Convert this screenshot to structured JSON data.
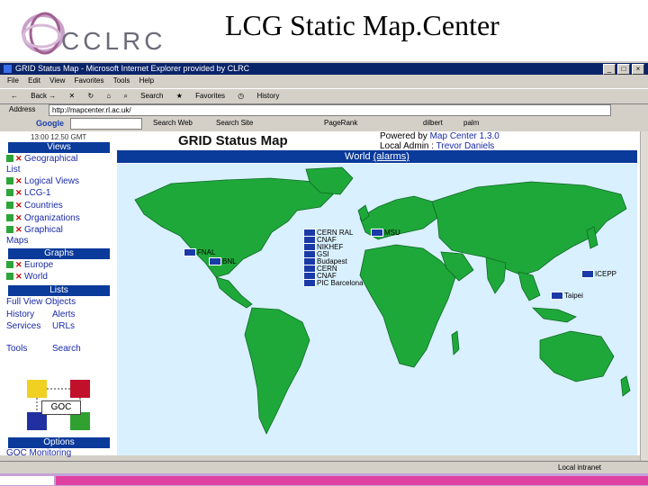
{
  "slide": {
    "title": "LCG Static Map.Center",
    "logo_text": "CCLRC"
  },
  "browser": {
    "window_title": "GRID Status Map - Microsoft Internet Explorer provided by CLRC",
    "menu": [
      "File",
      "Edit",
      "View",
      "Favorites",
      "Tools",
      "Help"
    ],
    "toolbar": [
      "Back",
      "Search",
      "Favorites",
      "History"
    ],
    "address_label": "Address",
    "address_value": "http://mapcenter.rl.ac.uk/",
    "google_label": "Google",
    "google_items": [
      "Search Web",
      "Search Site",
      "PageRank",
      "dilbert",
      "palm"
    ],
    "status_zone": "Local intranet"
  },
  "sidebar": {
    "timestamp": "13:00 12.50 GMT",
    "views_header": "Views",
    "view_items": [
      "Geographical",
      "List",
      "Logical Views",
      "LCG-1",
      "Countries",
      "Organizations",
      "Graphical",
      "Maps"
    ],
    "graphs_header": "Graphs",
    "graph_items": [
      "Europe",
      "World"
    ],
    "lists_header": "Lists",
    "list_items": [
      "Full View Objects",
      "History",
      "Alerts",
      "Services",
      "URLs"
    ],
    "tools_label": "Tools",
    "search_label": "Search",
    "goc_label": "GOC",
    "options_header": "Options",
    "goc_monitoring": "GOC Monitoring"
  },
  "main": {
    "title": "GRID Status Map",
    "powered_by_label": "Powered by",
    "powered_by_value": "Map Center 1.3.0",
    "local_admin_label": "Local Admin :",
    "local_admin_value": "Trevor Daniels",
    "world_label": "World",
    "alarms_link": "(alarms)",
    "sites": [
      {
        "name": "CERN RAL",
        "id": "site-cern-ral"
      },
      {
        "name": "CNAF",
        "id": "site-cnaf"
      },
      {
        "name": "NIKHEF",
        "id": "site-nikhef"
      },
      {
        "name": "GSI",
        "id": "site-gsi"
      },
      {
        "name": "Budapest",
        "id": "site-budapest"
      },
      {
        "name": "CERN",
        "id": "site-cern"
      },
      {
        "name": "CNAF",
        "id": "site-cnaf-2"
      },
      {
        "name": "PIC Barcelona",
        "id": "site-pic"
      },
      {
        "name": "MSU",
        "id": "site-msu"
      },
      {
        "name": "FNAL",
        "id": "site-fnal"
      },
      {
        "name": "BNL",
        "id": "site-bnl"
      },
      {
        "name": "ICEPP",
        "id": "site-icepp"
      },
      {
        "name": "Taipei",
        "id": "site-taipei"
      }
    ]
  },
  "colors": {
    "nav_blue": "#0a3a9a",
    "land_green": "#1fa83a",
    "ocean": "#d8f0ff",
    "link_blue": "#1a2aa8"
  }
}
